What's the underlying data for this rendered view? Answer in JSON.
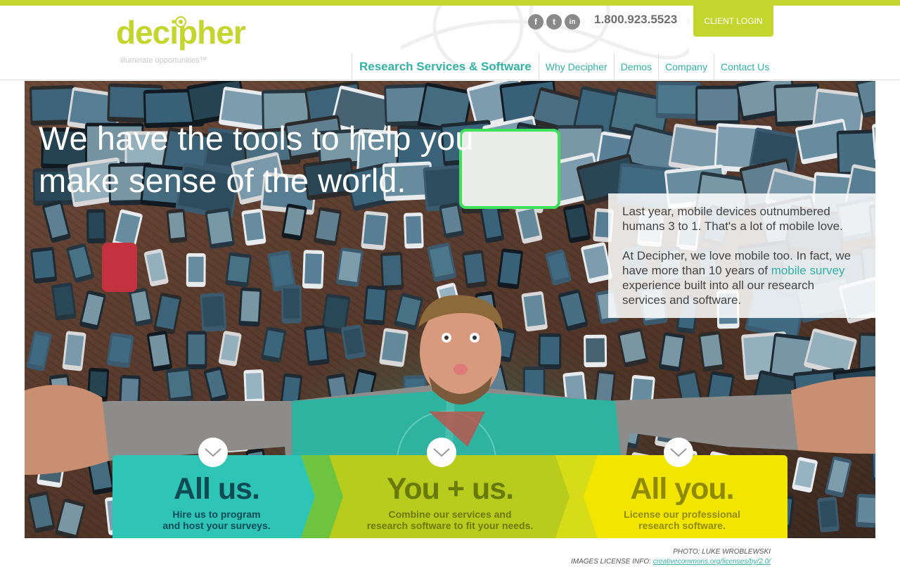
{
  "logo": {
    "word": "decipher",
    "tagline": "illuminate opportunities™"
  },
  "header": {
    "phone": "1.800.923.5523",
    "login_label": "CLIENT LOGIN",
    "social": [
      {
        "icon": "facebook-icon",
        "glyph": "f"
      },
      {
        "icon": "twitter-icon",
        "glyph": "t"
      },
      {
        "icon": "linkedin-icon",
        "glyph": "in"
      }
    ]
  },
  "nav": {
    "items": [
      {
        "label": "Research Services & Software"
      },
      {
        "label": "Why Decipher"
      },
      {
        "label": "Demos"
      },
      {
        "label": "Company"
      },
      {
        "label": "Contact Us"
      }
    ]
  },
  "hero": {
    "headline_line1": "We have the tools to help you",
    "headline_line2": "make sense of the world.",
    "info_p1": "Last year, mobile devices outnumbered humans 3 to 1. That's a lot of mobile love.",
    "info_p2_before": "At Decipher, we love mobile too. In fact, we have more than 10 years of ",
    "info_p2_link": "mobile survey",
    "info_p2_after": " experience built into all our research services and software."
  },
  "panels": [
    {
      "title": "All us.",
      "sub1": "Hire us to program",
      "sub2": "and host your surveys."
    },
    {
      "title": "You + us.",
      "sub1": "Combine our services and",
      "sub2": "research software to fit your needs."
    },
    {
      "title": "All you.",
      "sub1": "License our professional",
      "sub2": "research software."
    }
  ],
  "credits": {
    "photo": "PHOTO: LUKE WROBLEWSKI",
    "license_label": "IMAGES LICENSE INFO: ",
    "license_link": "creativecommons.org/licenses/by/2.0/"
  },
  "colors": {
    "brand_green": "#c4d52e",
    "teal": "#34b1a6",
    "panel_teal": "#2ec4b6",
    "panel_green": "#b8cc1e",
    "panel_yellow": "#f2e600"
  }
}
